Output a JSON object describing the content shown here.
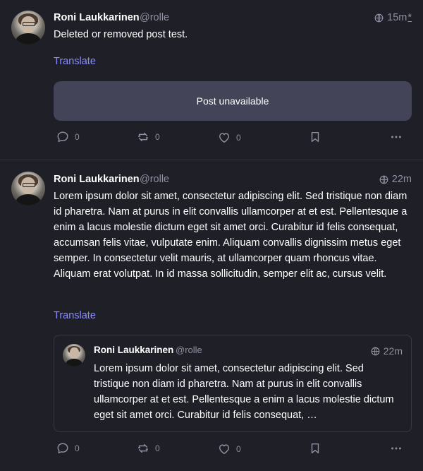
{
  "posts": [
    {
      "author": "Roni Laukkarinen",
      "handle": "@rolle",
      "time": "15m",
      "edited_marker": "*",
      "content": "Deleted or removed post test.",
      "translate": "Translate",
      "unavailable": "Post unavailable",
      "actions": {
        "replies": "0",
        "boosts": "0",
        "likes": "0"
      }
    },
    {
      "author": "Roni Laukkarinen",
      "handle": "@rolle",
      "time": "22m",
      "content": "Lorem ipsum dolor sit amet, consectetur adipiscing elit. Sed tristique non diam id pharetra. Nam at purus in elit convallis ullamcorper at et est. Pellentesque a enim a lacus molestie dictum eget sit amet orci. Curabitur id felis consequat, accumsan felis vitae, vulputate enim. Aliquam convallis dignissim metus eget semper. In consectetur velit mauris, at ullamcorper quam rhoncus vitae. Aliquam erat volutpat. In id massa sollicitudin, semper elit ac, cursus velit.",
      "translate": "Translate",
      "quote": {
        "author": "Roni Laukkarinen",
        "handle": "@rolle",
        "time": "22m",
        "content": "Lorem ipsum dolor sit amet, consectetur adipiscing elit. Sed tristique non diam id pharetra. Nam at purus in elit convallis ullamcorper at et est. Pellentesque a enim a lacus molestie dictum eget sit amet orci. Curabitur id felis consequat, …"
      },
      "actions": {
        "replies": "0",
        "boosts": "0",
        "likes": "0"
      }
    }
  ],
  "colors": {
    "background": "#1f1f28",
    "accent": "#8c8dff",
    "muted": "#8f8fa1",
    "card": "#444458"
  },
  "icons": [
    "globe-icon",
    "reply-icon",
    "boost-icon",
    "heart-icon",
    "bookmark-icon",
    "more-icon"
  ]
}
